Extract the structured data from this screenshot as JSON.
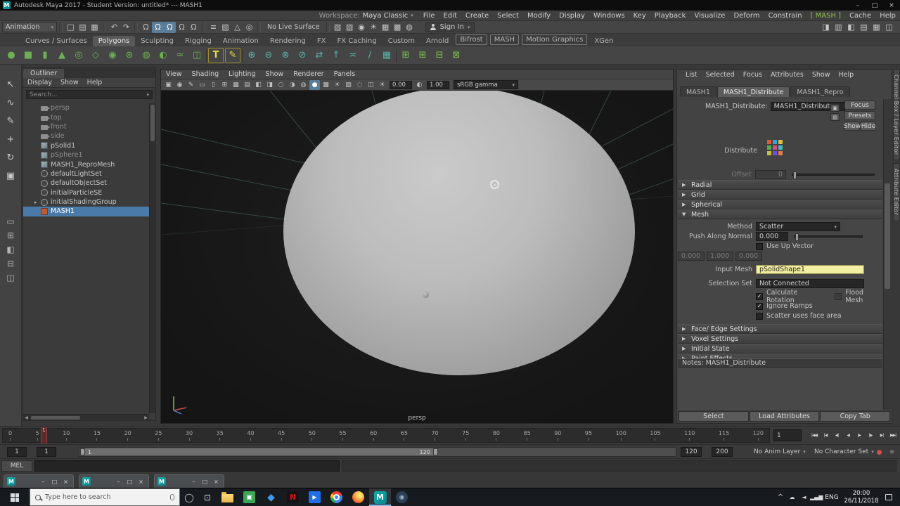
{
  "colors": {
    "selection_blue": "#4a7aa8",
    "accent_green": "#8fbf4a",
    "field_yellow": "#f3efa0",
    "maya_teal": "#14a3a3",
    "viewport_bg": "#1a1a1a"
  },
  "ui": {
    "dropdown_arrow": "▾",
    "collapsed_arrow": "▶",
    "expanded_arrow": "▼",
    "check": "✓",
    "tree_expand": "▸",
    "scroll_left": "◀",
    "scroll_right": "▶"
  },
  "titlebar": {
    "title": "Autodesk Maya 2017 - Student Version: untitled* --- MASH1",
    "minimize": "–",
    "maximize": "□",
    "close": "×"
  },
  "menubar": {
    "items": [
      {
        "label": "File"
      },
      {
        "label": "Edit"
      },
      {
        "label": "Create"
      },
      {
        "label": "Select"
      },
      {
        "label": "Modify"
      },
      {
        "label": "Display"
      },
      {
        "label": "Windows"
      },
      {
        "label": "Key"
      },
      {
        "label": "Playback"
      },
      {
        "label": "Visualize"
      },
      {
        "label": "Deform"
      },
      {
        "label": "Constrain"
      },
      {
        "label": "MASH",
        "cls": "mash-accent"
      },
      {
        "label": "Cache"
      },
      {
        "label": "Help"
      }
    ],
    "workspace_label": "Workspace:",
    "workspace_value": "Maya Classic"
  },
  "statusline": {
    "mode": "Animation",
    "file_icons": [
      {
        "name": "new-scene-icon",
        "glyph": "□"
      },
      {
        "name": "open-scene-icon",
        "glyph": "▤"
      },
      {
        "name": "save-scene-icon",
        "glyph": "▦"
      }
    ],
    "history_icons": [
      {
        "name": "undo-icon",
        "glyph": "↶"
      },
      {
        "name": "redo-icon",
        "glyph": "↷"
      }
    ],
    "snap_icons": [
      {
        "name": "snap-to-grid-icon",
        "glyph": "Ω"
      },
      {
        "name": "snap-to-curve-icon",
        "glyph": "Ω",
        "cls": "on"
      },
      {
        "name": "snap-to-point-icon",
        "glyph": "Ω",
        "cls": "on"
      },
      {
        "name": "snap-to-plane-icon",
        "glyph": "Ω"
      },
      {
        "name": "make-live-icon",
        "glyph": "Ω"
      }
    ],
    "selection_icons": [
      {
        "name": "construction-history-icon",
        "glyph": "≡"
      },
      {
        "name": "highlight-selection-icon",
        "glyph": "▧"
      },
      {
        "name": "object-mode-icon",
        "glyph": "△"
      },
      {
        "name": "component-mode-icon",
        "glyph": "◎"
      }
    ],
    "surface_label": "No Live Surface",
    "render_icons": [
      {
        "name": "open-render-view-icon",
        "glyph": "▧"
      },
      {
        "name": "render-current-frame-icon",
        "glyph": "▨"
      },
      {
        "name": "ipr-render-icon",
        "glyph": "◉"
      },
      {
        "name": "render-settings-icon",
        "glyph": "☀"
      },
      {
        "name": "hypershade-icon",
        "glyph": "▦"
      },
      {
        "name": "light-editor-icon",
        "glyph": "▩"
      },
      {
        "name": "paint-effects-icon",
        "glyph": "◍"
      }
    ],
    "sign_in_label": "Sign In",
    "panel_toggles": [
      {
        "name": "toggle-modeling-toolkit-icon",
        "glyph": "◨"
      },
      {
        "name": "toggle-humanik-icon",
        "glyph": "▥"
      },
      {
        "name": "toggle-attribute-editor-icon",
        "glyph": "◧"
      },
      {
        "name": "toggle-tool-settings-icon",
        "glyph": "▤"
      },
      {
        "name": "toggle-channel-box-icon",
        "glyph": "▦"
      },
      {
        "name": "toggle-outliner-icon",
        "glyph": "◫"
      }
    ]
  },
  "shelf": {
    "tabs": [
      {
        "label": "Curves / Surfaces"
      },
      {
        "label": "Polygons",
        "active": true
      },
      {
        "label": "Sculpting"
      },
      {
        "label": "Rigging"
      },
      {
        "label": "Animation"
      },
      {
        "label": "Rendering"
      },
      {
        "label": "FX"
      },
      {
        "label": "FX Caching"
      },
      {
        "label": "Custom"
      },
      {
        "label": "Arnold"
      },
      {
        "label": "Bifrost",
        "cls": "boxed"
      },
      {
        "label": "MASH",
        "cls": "boxed"
      },
      {
        "label": "Motion Graphics",
        "cls": "boxed"
      },
      {
        "label": "XGen"
      }
    ],
    "icons": [
      {
        "name": "poly-sphere-icon",
        "glyph": "●",
        "cls": "g"
      },
      {
        "name": "poly-cube-icon",
        "glyph": "■",
        "cls": "g"
      },
      {
        "name": "poly-cylinder-icon",
        "glyph": "▮",
        "cls": "g"
      },
      {
        "name": "poly-cone-icon",
        "glyph": "▲",
        "cls": "g"
      },
      {
        "name": "poly-torus-icon",
        "glyph": "◎",
        "cls": "g"
      },
      {
        "name": "poly-plane-icon",
        "glyph": "◇",
        "cls": "g"
      },
      {
        "name": "poly-disc-icon",
        "glyph": "◉",
        "cls": "g"
      },
      {
        "name": "poly-gear-icon",
        "glyph": "⊛",
        "cls": "g"
      },
      {
        "name": "poly-soccer-ball-icon",
        "glyph": "◍",
        "cls": "g"
      },
      {
        "name": "poly-super-ellipse-icon",
        "glyph": "◐",
        "cls": "g"
      },
      {
        "name": "poly-helix-icon",
        "glyph": "≈",
        "cls": "g"
      },
      {
        "name": "poly-pipe-icon",
        "glyph": "◫",
        "cls": "g"
      },
      {
        "name": "shelf-divider",
        "glyph": "",
        "cls": "sep"
      },
      {
        "name": "type-tool-icon",
        "glyph": "T",
        "cls": "y"
      },
      {
        "name": "svg-tool-icon",
        "glyph": "✎",
        "cls": "y"
      },
      {
        "name": "shelf-divider",
        "glyph": "",
        "cls": "sep"
      },
      {
        "name": "combine-icon",
        "glyph": "⊕",
        "cls": "t"
      },
      {
        "name": "separate-icon",
        "glyph": "⊖",
        "cls": "t"
      },
      {
        "name": "boolean-union-icon",
        "glyph": "⊗",
        "cls": "t"
      },
      {
        "name": "boolean-difference-icon",
        "glyph": "⊘",
        "cls": "t"
      },
      {
        "name": "mirror-icon",
        "glyph": "⇄",
        "cls": "t"
      },
      {
        "name": "extrude-icon",
        "glyph": "↑",
        "cls": "t"
      },
      {
        "name": "bridge-icon",
        "glyph": "≍",
        "cls": "t"
      },
      {
        "name": "multi-cut-icon",
        "glyph": "∕",
        "cls": "t"
      },
      {
        "name": "quad-draw-icon",
        "glyph": "▦",
        "cls": "t"
      },
      {
        "name": "shelf-divider",
        "glyph": "",
        "cls": "sep"
      },
      {
        "name": "mash-network-icon",
        "glyph": "⊞",
        "cls": "gr"
      },
      {
        "name": "mash-add-node-icon",
        "glyph": "⊞",
        "cls": "gr"
      },
      {
        "name": "mash-remove-node-icon",
        "glyph": "⊟",
        "cls": "gr"
      },
      {
        "name": "mash-repro-icon",
        "glyph": "⊠",
        "cls": "gr"
      }
    ]
  },
  "toolbox": {
    "tools": [
      {
        "name": "select-tool",
        "glyph": "↖"
      },
      {
        "name": "lasso-select-tool",
        "glyph": "∿"
      },
      {
        "name": "paint-select-tool",
        "glyph": "✎"
      },
      {
        "name": "move-tool",
        "glyph": "+"
      },
      {
        "name": "rotate-tool",
        "glyph": "↻"
      },
      {
        "name": "scale-tool",
        "glyph": "▣"
      }
    ],
    "layouts": [
      {
        "name": "layout-single-pane",
        "glyph": "▭"
      },
      {
        "name": "layout-four-panes",
        "glyph": "⊞"
      },
      {
        "name": "layout-persp-outliner",
        "glyph": "◧"
      },
      {
        "name": "layout-persp-graph",
        "glyph": "⊟"
      },
      {
        "name": "layout-hypershade-persp",
        "glyph": "◫"
      }
    ]
  },
  "outliner": {
    "header": "Outliner",
    "menus": [
      "Display",
      "Show",
      "Help"
    ],
    "search_placeholder": "Search...",
    "expand_glyph": "▸",
    "items": [
      {
        "label": "persp",
        "icon": "ic-camera",
        "cls": "dim"
      },
      {
        "label": "top",
        "icon": "ic-camera",
        "cls": "dim"
      },
      {
        "label": "front",
        "icon": "ic-camera",
        "cls": "dim"
      },
      {
        "label": "side",
        "icon": "ic-camera",
        "cls": "dim"
      },
      {
        "label": "pSolid1",
        "icon": "ic-mesh"
      },
      {
        "label": "pSphere1",
        "icon": "ic-mesh",
        "cls": "dim"
      },
      {
        "label": "MASH1_ReproMesh",
        "icon": "ic-mesh"
      },
      {
        "label": "defaultLightSet",
        "icon": "ic-set"
      },
      {
        "label": "defaultObjectSet",
        "icon": "ic-set"
      },
      {
        "label": "initialParticleSE",
        "icon": "ic-set"
      },
      {
        "label": "initialShadingGroup",
        "icon": "ic-set",
        "cls": "has-expand"
      },
      {
        "label": "MASH1",
        "icon": "ic-mash",
        "active": true
      }
    ]
  },
  "viewport": {
    "menus": [
      "View",
      "Shading",
      "Lighting",
      "Show",
      "Renderer",
      "Panels"
    ],
    "toolbar_icons": [
      {
        "name": "select-camera-icon",
        "glyph": "▣"
      },
      {
        "name": "lock-camera-icon",
        "glyph": "◉"
      },
      {
        "name": "camera-attributes-icon",
        "glyph": "✎"
      },
      {
        "name": "bookmarks-icon",
        "glyph": "▭"
      },
      {
        "name": "image-plane-icon",
        "glyph": "▯"
      },
      {
        "name": "view-grid-icon",
        "glyph": "⊞"
      },
      {
        "name": "film-gate-icon",
        "glyph": "▦"
      },
      {
        "name": "resolution-gate-icon",
        "glyph": "▤"
      },
      {
        "name": "gate-mask-icon",
        "glyph": "◧"
      },
      {
        "name": "field-chart-icon",
        "glyph": "◨"
      },
      {
        "name": "safe-action-icon",
        "glyph": "○"
      },
      {
        "name": "safe-title-icon",
        "glyph": "◑"
      },
      {
        "name": "wireframe-icon",
        "glyph": "◍"
      },
      {
        "name": "shaded-mode-icon",
        "glyph": "●",
        "cls": "on"
      },
      {
        "name": "textured-mode-icon",
        "glyph": "▩"
      },
      {
        "name": "use-all-lights-icon",
        "glyph": "☀"
      },
      {
        "name": "shadows-icon",
        "glyph": "▨"
      },
      {
        "name": "screen-space-ao-icon",
        "glyph": "◌"
      },
      {
        "name": "isolate-select-icon",
        "glyph": "◫"
      }
    ],
    "exposure_icon": "☀",
    "exposure": "0.00",
    "gamma_icon": "◐",
    "gamma": "1.00",
    "view_transform": "sRGB gamma",
    "camera_label": "persp"
  },
  "attribute_editor": {
    "menus": [
      "List",
      "Selected",
      "Focus",
      "Attributes",
      "Show",
      "Help"
    ],
    "tabs": [
      {
        "label": "MASH1"
      },
      {
        "label": "MASH1_Distribute",
        "active": true
      },
      {
        "label": "MASH1_Repro"
      }
    ],
    "node_label": "MASH1_Distribute:",
    "node_value": "MASH1_Distribute",
    "focus_label": "Focus",
    "presets_label": "Presets",
    "show_label": "Show",
    "hide_label": "Hide",
    "distribute_label": "Distribute",
    "offset_label": "Offset",
    "offset_value": "0",
    "sections_top": [
      {
        "label": "Radial"
      },
      {
        "label": "Grid"
      },
      {
        "label": "Spherical"
      }
    ],
    "mesh_section_label": "Mesh",
    "mesh": {
      "method_label": "Method",
      "method_value": "Scatter",
      "push_label": "Push Along Normal",
      "push_value": "0.000",
      "use_up_vector_label": "Use Up Vector",
      "up_vector_label": "Up Vector",
      "up_vector": [
        "0.000",
        "1.000",
        "0.000"
      ],
      "input_mesh_label": "Input Mesh",
      "input_mesh_value": "pSolidShape1",
      "selection_set_label": "Selection Set",
      "selection_set_value": "Not Connected",
      "calc_rotation_label": "Calculate Rotation",
      "flood_mesh_label": "Flood Mesh",
      "ignore_ramps_label": "Ignore Ramps",
      "scatter_face_label": "Scatter uses face area"
    },
    "sections_bottom": [
      {
        "label": "Face/ Edge Settings"
      },
      {
        "label": "Voxel Settings"
      },
      {
        "label": "Initial State"
      },
      {
        "label": "Paint Effects"
      }
    ],
    "notes_label": "Notes: MASH1_Distribute",
    "footer": [
      {
        "label": "Select",
        "name": "select-button"
      },
      {
        "label": "Load Attributes",
        "name": "load-attributes-button"
      },
      {
        "label": "Copy Tab",
        "name": "copy-tab-button"
      }
    ]
  },
  "side_tabs": [
    {
      "label": "Channel Box / Layer Editor",
      "name": "channel-box-layer-editor-tab"
    },
    {
      "label": "Attribute Editor",
      "name": "attribute-editor-tab"
    }
  ],
  "timeline": {
    "ticks": [
      "0",
      "5",
      "10",
      "15",
      "20",
      "25",
      "30",
      "35",
      "40",
      "45",
      "50",
      "55",
      "60",
      "65",
      "70",
      "75",
      "80",
      "85",
      "90",
      "95",
      "100",
      "105",
      "110",
      "115",
      "120"
    ],
    "marker_label": "1",
    "current_frame": "1",
    "playback": [
      {
        "name": "go-to-start-button",
        "glyph": "|◀◀"
      },
      {
        "name": "step-back-frame-button",
        "glyph": "|◀"
      },
      {
        "name": "step-back-key-button",
        "glyph": "◀|"
      },
      {
        "name": "play-backwards-button",
        "glyph": "◀"
      },
      {
        "name": "play-forwards-button",
        "glyph": "▶"
      },
      {
        "name": "step-forward-key-button",
        "glyph": "|▶"
      },
      {
        "name": "step-forward-frame-button",
        "glyph": "▶|"
      },
      {
        "name": "go-to-end-button",
        "glyph": "▶▶|"
      }
    ]
  },
  "range": {
    "playback_start": "1",
    "anim_start": "1",
    "bar_start_label": "1",
    "bar_end_label": "120",
    "playback_end": "120",
    "anim_end": "200",
    "anim_layer": "No Anim Layer",
    "char_set": "No Character Set",
    "autokey_glyph": "●",
    "prefs_glyph": "☼"
  },
  "command_line": {
    "label": "MEL"
  },
  "mini_windows": [
    {
      "name": "maya-floating-window"
    },
    {
      "name": "maya-floating-window"
    },
    {
      "name": "maya-floating-window"
    }
  ],
  "mini_window_buttons": {
    "app_letter": "M",
    "minimize": "–",
    "restore": "□",
    "close": "×"
  },
  "taskbar": {
    "search_placeholder": "Type here to search",
    "cortana_glyph": "◯",
    "task_view_glyph": "⊡",
    "apps": [
      {
        "name": "file-explorer-icon",
        "cls": "app-folder",
        "glyph": ""
      },
      {
        "name": "taskbar-app-icon",
        "cls": "app-green",
        "glyph": "▣"
      },
      {
        "name": "dropbox-icon",
        "cls": "app-dropbox",
        "glyph": "◆"
      },
      {
        "name": "netflix-icon",
        "cls": "app-netflix",
        "glyph": "N"
      },
      {
        "name": "movies-tv-icon",
        "cls": "app-movies",
        "glyph": "▶"
      },
      {
        "name": "chrome-icon",
        "cls": "app-chrome",
        "glyph": ""
      },
      {
        "name": "firefox-icon",
        "cls": "app-firefox",
        "glyph": ""
      },
      {
        "name": "maya-taskbar-icon",
        "cls": "app-maya",
        "glyph": "M",
        "active": true
      },
      {
        "name": "taskbar-app-icon",
        "cls": "app-dark",
        "glyph": "◉"
      }
    ],
    "tray": {
      "caret": "^",
      "icons": [
        {
          "name": "onedrive-icon",
          "glyph": "☁"
        },
        {
          "name": "volume-icon",
          "glyph": "◄"
        },
        {
          "name": "network-icon",
          "glyph": "▂▄▆"
        }
      ],
      "lang": "ENG",
      "time": "20:00",
      "date": "26/11/2018"
    }
  }
}
